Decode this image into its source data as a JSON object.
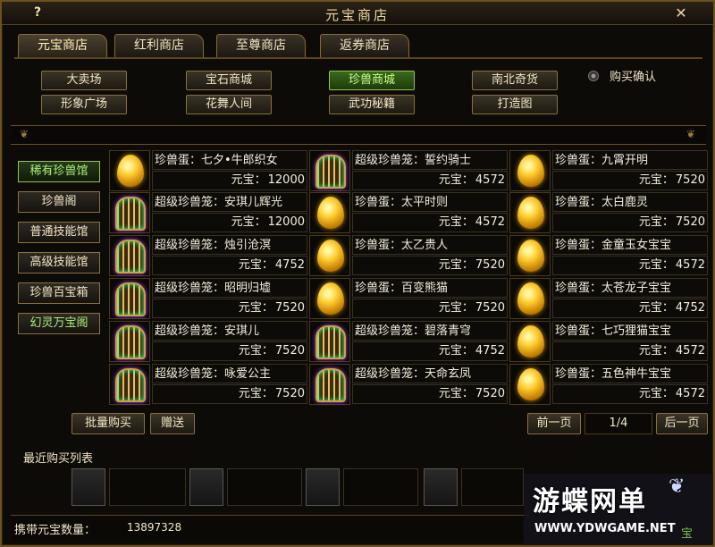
{
  "window": {
    "title": "元宝商店",
    "help_label": "?",
    "close_label": "✕"
  },
  "tabs": [
    {
      "label": "元宝商店"
    },
    {
      "label": "红利商店"
    },
    {
      "label": "至尊商店"
    },
    {
      "label": "返券商店"
    }
  ],
  "categories": [
    {
      "label": "大卖场"
    },
    {
      "label": "宝石商城"
    },
    {
      "label": "珍兽商城",
      "active": true
    },
    {
      "label": "南北奇货"
    },
    {
      "label": "形象广场"
    },
    {
      "label": "花舞人间"
    },
    {
      "label": "武功秘籍"
    },
    {
      "label": "打造图"
    }
  ],
  "confirm_option": {
    "label": "购买确认"
  },
  "sidebar": [
    {
      "label": "稀有珍兽馆",
      "active": true
    },
    {
      "label": "珍兽阁"
    },
    {
      "label": "普通技能馆"
    },
    {
      "label": "高级技能馆"
    },
    {
      "label": "珍兽百宝箱"
    },
    {
      "label": "幻灵万宝阁"
    }
  ],
  "currency_label": "元宝：",
  "items": [
    {
      "name": "珍兽蛋：七夕•牛郎织女",
      "price": "12000",
      "icon": "egg-icon"
    },
    {
      "name": "超级珍兽笼：誓约骑士",
      "price": "4572",
      "icon": "cage-icon"
    },
    {
      "name": "珍兽蛋：九霄开明",
      "price": "7520",
      "icon": "egg-icon"
    },
    {
      "name": "超级珍兽笼：安琪儿辉光",
      "price": "12000",
      "icon": "cage-icon"
    },
    {
      "name": "珍兽蛋：太平时则",
      "price": "4572",
      "icon": "egg-icon"
    },
    {
      "name": "珍兽蛋：太白鹿灵",
      "price": "7520",
      "icon": "egg-icon"
    },
    {
      "name": "超级珍兽笼：烛引沧溟",
      "price": "4752",
      "icon": "cage-icon"
    },
    {
      "name": "珍兽蛋：太乙贵人",
      "price": "7520",
      "icon": "egg-icon"
    },
    {
      "name": "珍兽蛋：金童玉女宝宝",
      "price": "4572",
      "icon": "egg-icon"
    },
    {
      "name": "超级珍兽笼：昭明归墟",
      "price": "7520",
      "icon": "cage-icon"
    },
    {
      "name": "珍兽蛋：百变熊猫",
      "price": "7520",
      "icon": "egg-icon"
    },
    {
      "name": "珍兽蛋：太苍龙子宝宝",
      "price": "4752",
      "icon": "egg-icon"
    },
    {
      "name": "超级珍兽笼：安琪儿",
      "price": "7520",
      "icon": "cage-icon"
    },
    {
      "name": "超级珍兽笼：碧落青穹",
      "price": "4752",
      "icon": "cage-icon"
    },
    {
      "name": "珍兽蛋：七巧狸猫宝宝",
      "price": "4572",
      "icon": "egg-icon"
    },
    {
      "name": "超级珍兽笼：咏爱公主",
      "price": "7520",
      "icon": "cage-icon"
    },
    {
      "name": "超级珍兽笼：天命玄凤",
      "price": "7520",
      "icon": "cage-icon"
    },
    {
      "name": "珍兽蛋：五色神牛宝宝",
      "price": "4572",
      "icon": "egg-icon"
    }
  ],
  "actions": {
    "bulk_buy": "批量购买",
    "gift": "赠送",
    "prev_page": "前一页",
    "next_page": "后一页",
    "page": "1/4"
  },
  "recent": {
    "label": "最近购买列表"
  },
  "footer": {
    "label": "携带元宝数量：",
    "value": "13897328"
  },
  "watermark": {
    "title": "游蝶网单",
    "url": "WWW.YDWGAME.NET",
    "butterfly_icon": "butterfly-icon",
    "tail": "宝"
  }
}
